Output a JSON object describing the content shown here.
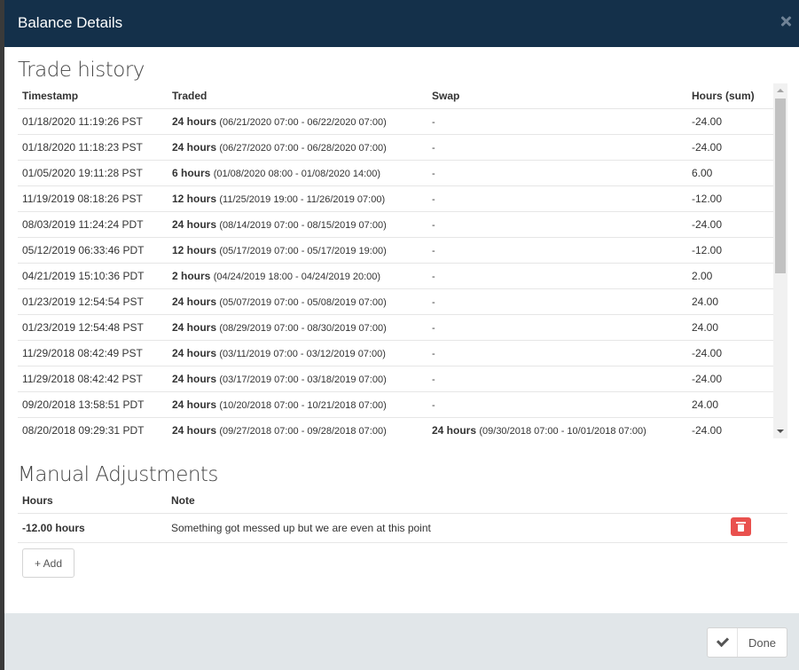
{
  "modal": {
    "title": "Balance Details"
  },
  "trade_history": {
    "title": "Trade history",
    "headers": [
      "Timestamp",
      "Traded",
      "Swap",
      "Hours (sum)"
    ],
    "rows": [
      {
        "timestamp": "01/18/2020 11:19:26 PST",
        "traded_bold": "24 hours",
        "traded_range": "(06/21/2020 07:00 - 06/22/2020 07:00)",
        "swap_bold": "",
        "swap_range": "-",
        "hours": "-24.00"
      },
      {
        "timestamp": "01/18/2020 11:18:23 PST",
        "traded_bold": "24 hours",
        "traded_range": "(06/27/2020 07:00 - 06/28/2020 07:00)",
        "swap_bold": "",
        "swap_range": "-",
        "hours": "-24.00"
      },
      {
        "timestamp": "01/05/2020 19:11:28 PST",
        "traded_bold": "6 hours",
        "traded_range": "(01/08/2020 08:00 - 01/08/2020 14:00)",
        "swap_bold": "",
        "swap_range": "-",
        "hours": "6.00"
      },
      {
        "timestamp": "11/19/2019 08:18:26 PST",
        "traded_bold": "12 hours",
        "traded_range": "(11/25/2019 19:00 - 11/26/2019 07:00)",
        "swap_bold": "",
        "swap_range": "-",
        "hours": "-12.00"
      },
      {
        "timestamp": "08/03/2019 11:24:24 PDT",
        "traded_bold": "24 hours",
        "traded_range": "(08/14/2019 07:00 - 08/15/2019 07:00)",
        "swap_bold": "",
        "swap_range": "-",
        "hours": "-24.00"
      },
      {
        "timestamp": "05/12/2019 06:33:46 PDT",
        "traded_bold": "12 hours",
        "traded_range": "(05/17/2019 07:00 - 05/17/2019 19:00)",
        "swap_bold": "",
        "swap_range": "-",
        "hours": "-12.00"
      },
      {
        "timestamp": "04/21/2019 15:10:36 PDT",
        "traded_bold": "2 hours",
        "traded_range": "(04/24/2019 18:00 - 04/24/2019 20:00)",
        "swap_bold": "",
        "swap_range": "-",
        "hours": "2.00"
      },
      {
        "timestamp": "01/23/2019 12:54:54 PST",
        "traded_bold": "24 hours",
        "traded_range": "(05/07/2019 07:00 - 05/08/2019 07:00)",
        "swap_bold": "",
        "swap_range": "-",
        "hours": "24.00"
      },
      {
        "timestamp": "01/23/2019 12:54:48 PST",
        "traded_bold": "24 hours",
        "traded_range": "(08/29/2019 07:00 - 08/30/2019 07:00)",
        "swap_bold": "",
        "swap_range": "-",
        "hours": "24.00"
      },
      {
        "timestamp": "11/29/2018 08:42:49 PST",
        "traded_bold": "24 hours",
        "traded_range": "(03/11/2019 07:00 - 03/12/2019 07:00)",
        "swap_bold": "",
        "swap_range": "-",
        "hours": "-24.00"
      },
      {
        "timestamp": "11/29/2018 08:42:42 PST",
        "traded_bold": "24 hours",
        "traded_range": "(03/17/2019 07:00 - 03/18/2019 07:00)",
        "swap_bold": "",
        "swap_range": "-",
        "hours": "-24.00"
      },
      {
        "timestamp": "09/20/2018 13:58:51 PDT",
        "traded_bold": "24 hours",
        "traded_range": "(10/20/2018 07:00 - 10/21/2018 07:00)",
        "swap_bold": "",
        "swap_range": "-",
        "hours": "24.00"
      },
      {
        "timestamp": "08/20/2018 09:29:31 PDT",
        "traded_bold": "24 hours",
        "traded_range": "(09/27/2018 07:00 - 09/28/2018 07:00)",
        "swap_bold": "24 hours",
        "swap_range": "(09/30/2018 07:00 - 10/01/2018 07:00)",
        "hours": "-24.00"
      }
    ]
  },
  "manual_adjustments": {
    "title": "Manual Adjustments",
    "headers": [
      "Hours",
      "Note"
    ],
    "rows": [
      {
        "hours": "-12.00 hours",
        "note": "Something got messed up but we are even at this point"
      }
    ],
    "add_label": "+ Add"
  },
  "footer": {
    "done_label": "Done"
  },
  "icons": {
    "close": "close-icon",
    "delete": "trash-icon",
    "done": "check-icon"
  },
  "colors": {
    "header_bg": "#14304a",
    "footer_bg": "#e1e6e9",
    "delete_bg": "#e9514e"
  }
}
